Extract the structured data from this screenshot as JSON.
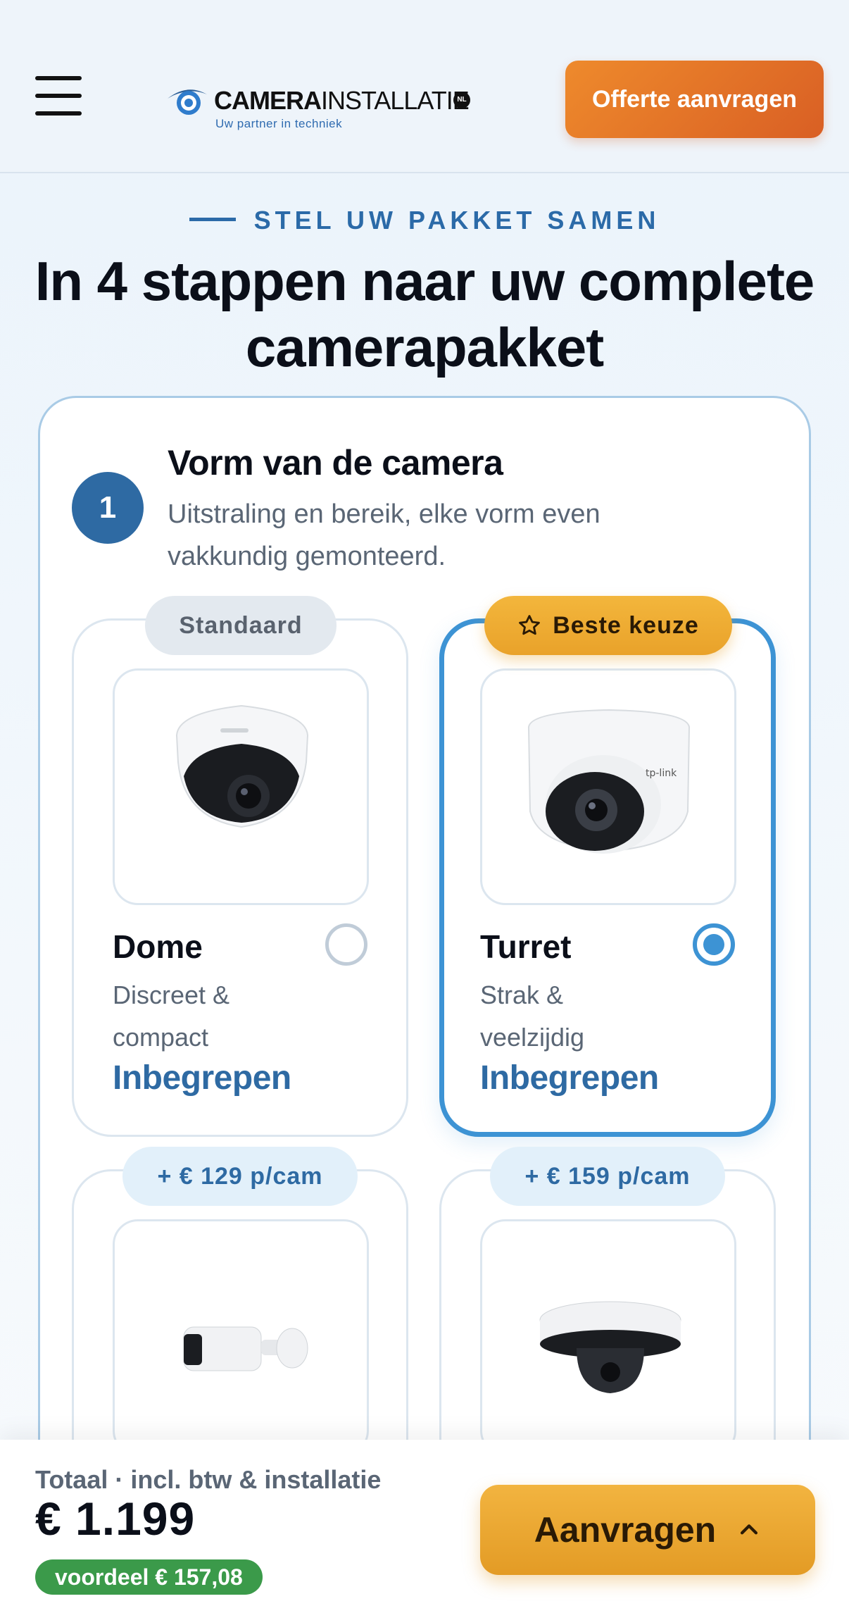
{
  "header": {
    "logo_bold": "CAMERA",
    "logo_thin": "INSTALLATIE",
    "logo_nl": "NL",
    "logo_tagline": "Uw partner in techniek",
    "quote_button": "Offerte aanvragen",
    "accent": "#e0712a"
  },
  "section": {
    "eyebrow": "STEL UW PAKKET SAMEN",
    "title": "In 4 stappen naar uw complete camerapakket"
  },
  "step": {
    "number": "1",
    "title": "Vorm van de camera",
    "description": "Uitstraling en bereik, elke vorm even vakkundig gemonteerd."
  },
  "options": [
    {
      "badge": "Standaard",
      "name": "Dome",
      "desc": "Discreet & compact",
      "price": "Inbegrepen",
      "selected": false,
      "icon": "dome-camera-icon"
    },
    {
      "badge": "Beste keuze",
      "name": "Turret",
      "desc": "Strak & veelzijdig",
      "price": "Inbegrepen",
      "selected": true,
      "icon": "turret-camera-icon"
    },
    {
      "badge": "+ € 129 p/cam",
      "icon": "bullet-camera-icon"
    },
    {
      "badge": "+ € 159 p/cam",
      "icon": "ptz-camera-icon"
    }
  ],
  "bottom": {
    "total_label": "Totaal · incl. btw & installatie",
    "total_price": "€ 1.199",
    "saving": "voordeel  € 157,08",
    "apply_button": "Aanvragen"
  }
}
